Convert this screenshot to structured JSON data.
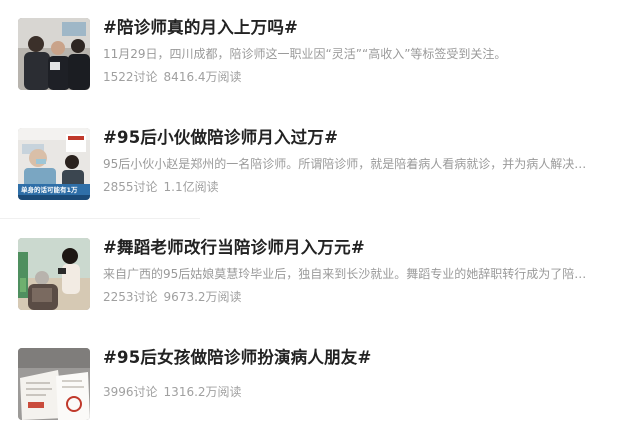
{
  "topics": [
    {
      "title": "#陪诊师真的月入上万吗#",
      "description": "11月29日，四川成都，陪诊师这一职业因“灵活”“高收入”等标签受到关注。",
      "discussions": "1522讨论",
      "reads": "8416.4万阅读",
      "thumb_icon": "hospital-crowd-photo"
    },
    {
      "title": "#95后小伙做陪诊师月入过万#",
      "description": "95后小伙小赵是郑州的一名陪诊师。所谓陪诊师，就是陪着病人看病就诊，并为病人解决…",
      "discussions": "2855讨论",
      "reads": "1.1亿阅读",
      "thumb_icon": "news-broadcast-photo",
      "thumb_caption": "单身的话可能有1万"
    },
    {
      "title": "#舞蹈老师改行当陪诊师月入万元#",
      "description": "来自广西的95后姑娘莫慧玲毕业后，独自来到长沙就业。舞蹈专业的她辞职转行成为了陪…",
      "discussions": "2253讨论",
      "reads": "9673.2万阅读",
      "thumb_icon": "patient-companion-photo"
    },
    {
      "title": "#95后女孩做陪诊师扮演病人朋友#",
      "description": "",
      "discussions": "3996讨论",
      "reads": "1316.2万阅读",
      "thumb_icon": "medical-documents-photo"
    }
  ]
}
